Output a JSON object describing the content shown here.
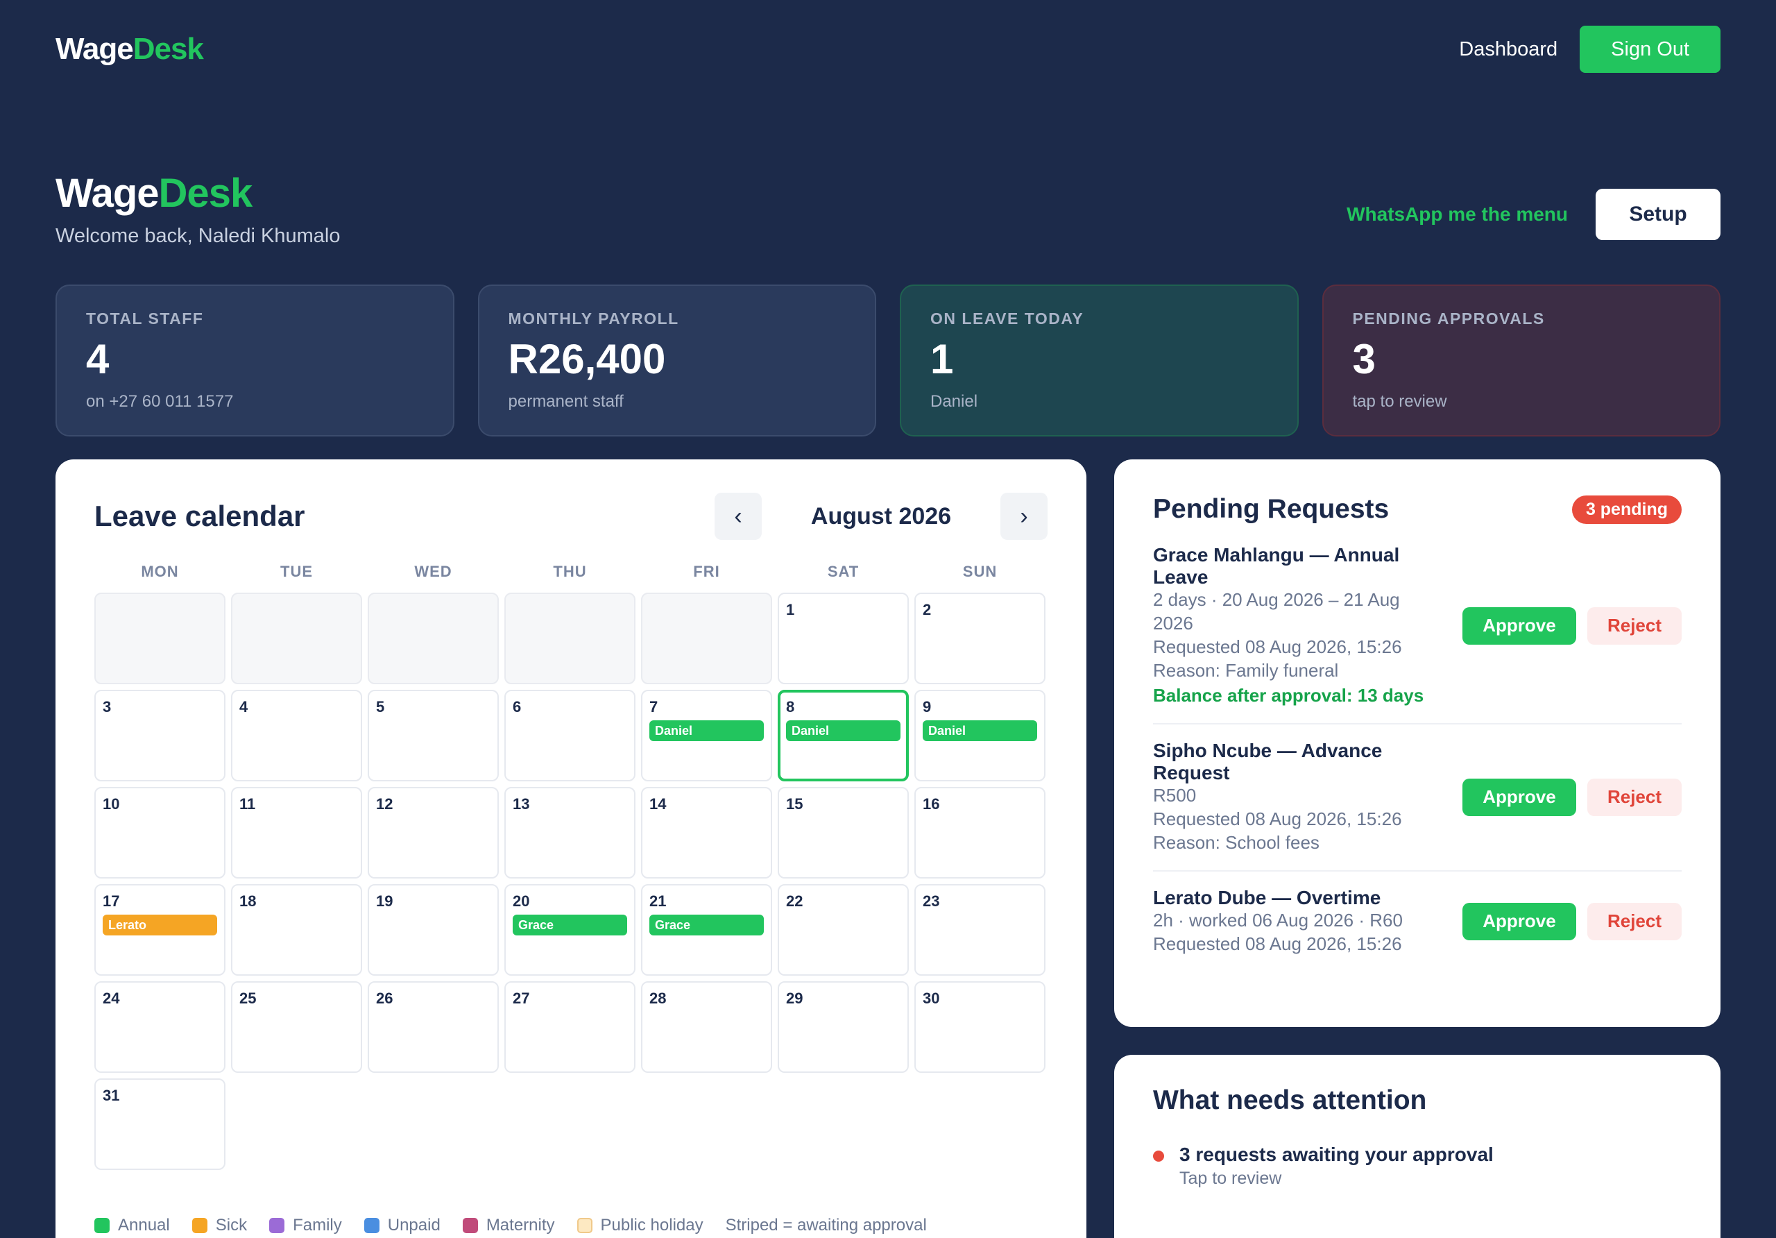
{
  "nav": {
    "brand_part1": "Wage",
    "brand_part2": "Desk",
    "dashboard": "Dashboard",
    "sign_out": "Sign Out"
  },
  "header": {
    "title_part1": "Wage",
    "title_part2": "Desk",
    "welcome": "Welcome back, Naledi Khumalo",
    "whatsapp": "WhatsApp me the menu",
    "setup": "Setup"
  },
  "stats": [
    {
      "label": "TOTAL STAFF",
      "value": "4",
      "sub": "on +27 60 011 1577"
    },
    {
      "label": "MONTHLY PAYROLL",
      "value": "R26,400",
      "sub": "permanent staff"
    },
    {
      "label": "ON LEAVE TODAY",
      "value": "1",
      "sub": "Daniel"
    },
    {
      "label": "PENDING APPROVALS",
      "value": "3",
      "sub": "tap to review"
    }
  ],
  "calendar": {
    "title": "Leave calendar",
    "month": "August 2026",
    "prev": "‹",
    "next": "›",
    "weekdays": [
      "MON",
      "TUE",
      "WED",
      "THU",
      "FRI",
      "SAT",
      "SUN"
    ],
    "leading_blanks": 5,
    "days_in_month": 31,
    "today": 8,
    "events": {
      "7": {
        "name": "Daniel",
        "type": "annual"
      },
      "8": {
        "name": "Daniel",
        "type": "annual"
      },
      "9": {
        "name": "Daniel",
        "type": "annual"
      },
      "17": {
        "name": "Lerato",
        "type": "sick"
      },
      "20": {
        "name": "Grace",
        "type": "annual"
      },
      "21": {
        "name": "Grace",
        "type": "annual"
      }
    },
    "legend": [
      {
        "label": "Annual",
        "color": "#22c55e"
      },
      {
        "label": "Sick",
        "color": "#f5a524"
      },
      {
        "label": "Family",
        "color": "#9b6bd6"
      },
      {
        "label": "Unpaid",
        "color": "#4a8ee0"
      },
      {
        "label": "Maternity",
        "color": "#c04b7a"
      },
      {
        "label": "Public holiday",
        "color": "#fde9c2"
      }
    ],
    "legend_note": "Striped = awaiting approval"
  },
  "pending": {
    "title": "Pending Requests",
    "badge": "3 pending",
    "approve_label": "Approve",
    "reject_label": "Reject",
    "requests": [
      {
        "title": "Grace Mahlangu — Annual Leave",
        "lines": [
          "2 days · 20 Aug 2026 – 21 Aug 2026",
          "Requested 08 Aug 2026, 15:26",
          "Reason: Family funeral"
        ],
        "balance": "Balance after approval: 13 days"
      },
      {
        "title": "Sipho Ncube — Advance Request",
        "lines": [
          "R500",
          "Requested 08 Aug 2026, 15:26",
          "Reason: School fees"
        ],
        "balance": ""
      },
      {
        "title": "Lerato Dube — Overtime",
        "lines": [
          "2h · worked 06 Aug 2026 · R60",
          "Requested 08 Aug 2026, 15:26"
        ],
        "balance": ""
      }
    ]
  },
  "attention": {
    "title": "What needs attention",
    "item_title": "3 requests awaiting your approval",
    "item_sub": "Tap to review"
  }
}
